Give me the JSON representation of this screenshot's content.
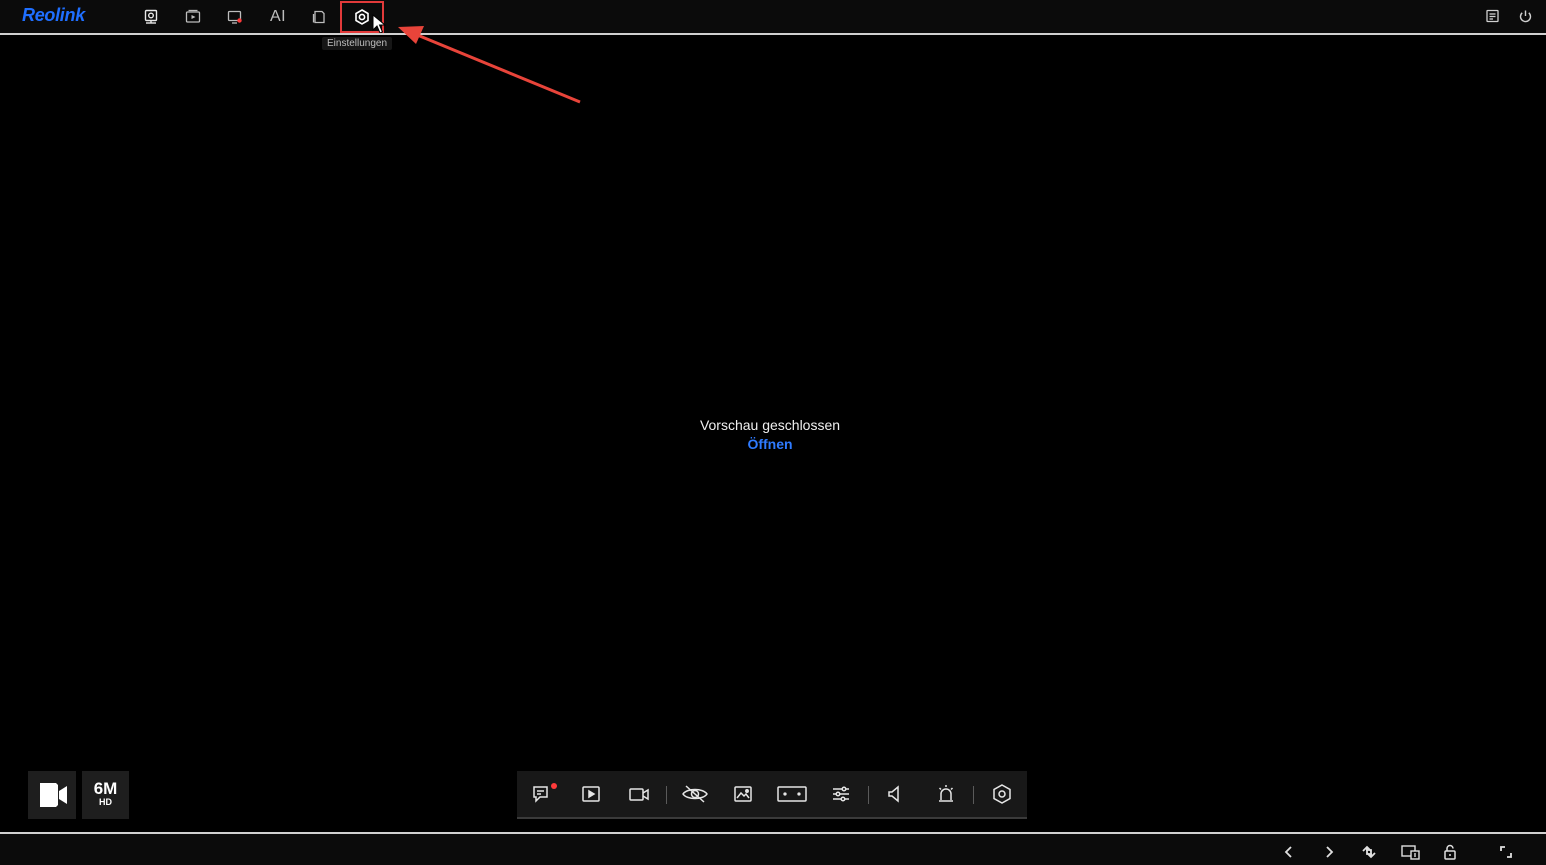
{
  "app": {
    "logo_text": "Reolink",
    "accent_color": "#1f6fff"
  },
  "nav": {
    "items": [
      {
        "name": "live-view",
        "icon": "camera-icon",
        "active": true
      },
      {
        "name": "playback",
        "icon": "playback-icon",
        "active": false
      },
      {
        "name": "recording",
        "icon": "monitor-record-icon",
        "active": false
      },
      {
        "name": "ai",
        "label": "AI",
        "active": false
      },
      {
        "name": "files",
        "icon": "file-icon",
        "active": false
      },
      {
        "name": "settings",
        "icon": "gear-icon",
        "active": false,
        "highlighted": true
      }
    ],
    "settings_tooltip": "Einstellungen"
  },
  "top_right": {
    "items": [
      {
        "name": "log",
        "icon": "document-icon"
      },
      {
        "name": "power",
        "icon": "power-icon"
      }
    ]
  },
  "preview": {
    "message": "Vorschau geschlossen",
    "open_label": "Öffnen"
  },
  "badges": {
    "camera_icon": "video-camera-icon",
    "resolution": "6M",
    "quality": "HD"
  },
  "toolbar": {
    "items": [
      {
        "name": "intercom",
        "icon": "chat-icon",
        "notification": true
      },
      {
        "name": "playback",
        "icon": "play-icon"
      },
      {
        "name": "record",
        "icon": "record-camera-icon"
      },
      {
        "name": "privacy-mask",
        "icon": "eye-off-icon"
      },
      {
        "name": "snapshot",
        "icon": "image-icon"
      },
      {
        "name": "aspect-ratio",
        "icon": "aspect-ratio-icon"
      },
      {
        "name": "image-settings",
        "icon": "sliders-icon"
      },
      {
        "name": "audio",
        "icon": "speaker-icon"
      },
      {
        "name": "siren",
        "icon": "siren-icon"
      },
      {
        "name": "settings",
        "icon": "gear-icon"
      }
    ]
  },
  "bottom_bar": {
    "items": [
      {
        "name": "previous",
        "icon": "chevron-left-icon"
      },
      {
        "name": "next",
        "icon": "chevron-right-icon"
      },
      {
        "name": "refresh",
        "icon": "refresh-icon"
      },
      {
        "name": "screen-layout",
        "icon": "screen-layout-icon"
      },
      {
        "name": "lock",
        "icon": "unlock-icon"
      },
      {
        "name": "fullscreen",
        "icon": "fullscreen-icon"
      }
    ]
  }
}
